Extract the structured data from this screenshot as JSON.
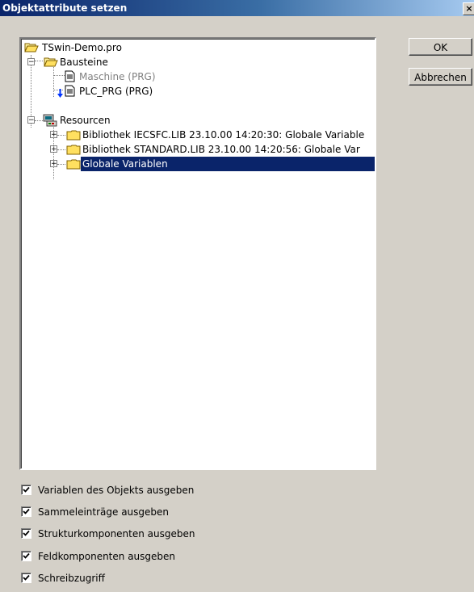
{
  "window": {
    "title": "Objektattribute setzen",
    "close_label": "×"
  },
  "tree": {
    "root": "TSwin-Demo.pro",
    "bausteine": "Bausteine",
    "maschine": "Maschine (PRG)",
    "plc_prg": "PLC_PRG (PRG)",
    "resourcen": "Resourcen",
    "lib_iecsfc": "Bibliothek IECSFC.LIB 23.10.00 14:20:30: Globale Variable",
    "lib_standard": "Bibliothek STANDARD.LIB 23.10.00 14:20:56: Globale Var",
    "globale": "Globale Variablen",
    "expander_minus": "−",
    "expander_plus": "+"
  },
  "buttons": {
    "ok": "OK",
    "cancel": "Abbrechen"
  },
  "options": [
    {
      "label": "Variablen des Objekts ausgeben",
      "checked": true
    },
    {
      "label": "Sammeleinträge ausgeben",
      "checked": true
    },
    {
      "label": "Strukturkomponenten ausgeben",
      "checked": true
    },
    {
      "label": "Feldkomponenten ausgeben",
      "checked": true
    },
    {
      "label": "Schreibzugriff",
      "checked": true
    }
  ]
}
